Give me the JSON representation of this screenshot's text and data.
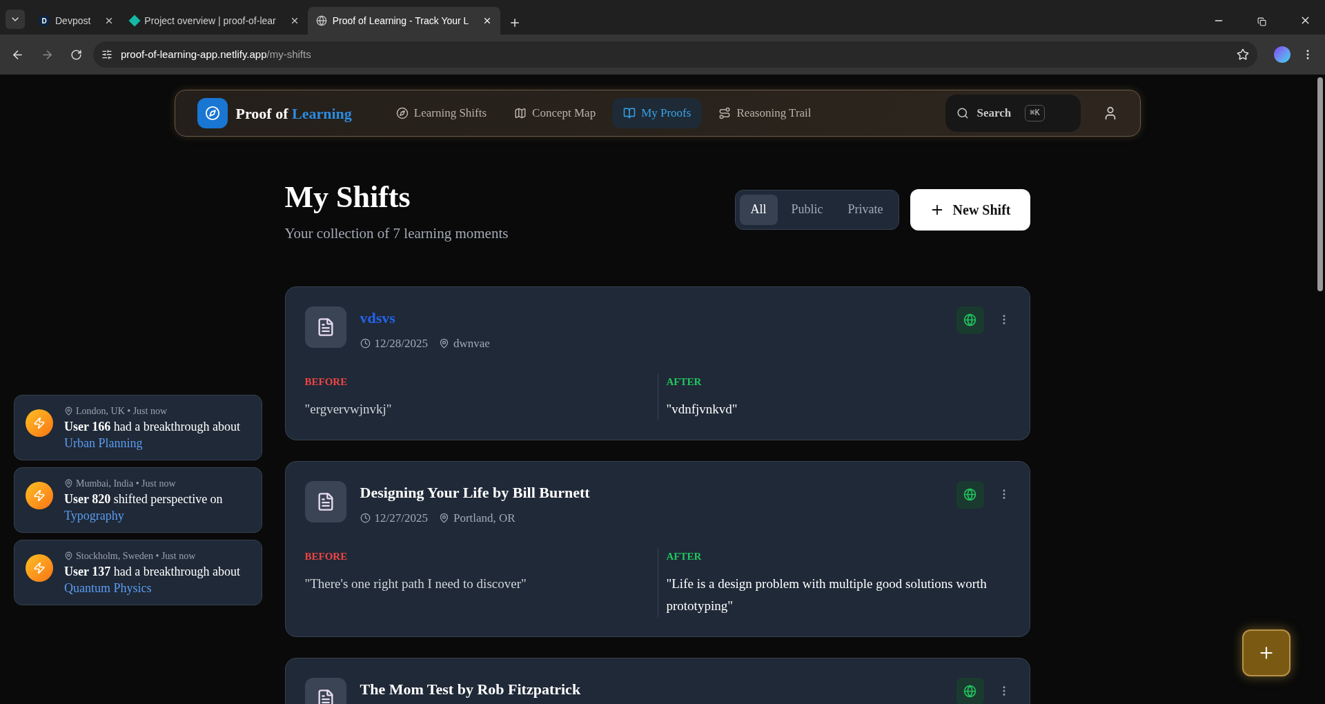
{
  "browser": {
    "tabs": [
      {
        "title": "Devpost",
        "letter": "D",
        "selected": false
      },
      {
        "title": "Project overview | proof-of-lear",
        "selected": false
      },
      {
        "title": "Proof of Learning - Track Your L",
        "selected": true
      }
    ],
    "url_host": "proof-of-learning-app.netlify.app",
    "url_path": "/my-shifts"
  },
  "nav": {
    "brand": [
      "Proof of",
      "Learning"
    ],
    "items": [
      {
        "label": "Learning Shifts",
        "selected": false
      },
      {
        "label": "Concept Map",
        "selected": false
      },
      {
        "label": "My Proofs",
        "selected": true
      },
      {
        "label": "Reasoning Trail",
        "selected": false
      }
    ],
    "search": {
      "label": "Search",
      "shortcut": "⌘K"
    }
  },
  "header": {
    "title": "My Shifts",
    "subtitle": "Your collection of 7 learning moments",
    "filters": [
      {
        "label": "All",
        "selected": true
      },
      {
        "label": "Public",
        "selected": false
      },
      {
        "label": "Private",
        "selected": false
      }
    ],
    "new_button": "New Shift"
  },
  "shifts": [
    {
      "title": "vdsvs",
      "highlighted": true,
      "date": "12/28/2025",
      "location": "dwnvae",
      "public": true,
      "before_label": "BEFORE",
      "before": "\"ergvervwjnvkj\"",
      "after_label": "AFTER",
      "after": "\"vdnfjvnkvd\""
    },
    {
      "title": "Designing Your Life by Bill Burnett",
      "highlighted": false,
      "date": "12/27/2025",
      "location": "Portland, OR",
      "public": true,
      "before_label": "BEFORE",
      "before": "\"There's one right path I need to discover\"",
      "after_label": "AFTER",
      "after": "\"Life is a design problem with multiple good solutions worth prototyping\""
    },
    {
      "title": "The Mom Test by Rob Fitzpatrick",
      "highlighted": false,
      "public": true
    }
  ],
  "toasts": [
    {
      "location": "London, UK • Just now",
      "message": "**User 166** had a breakthrough about",
      "topic": "Urban Planning"
    },
    {
      "location": "Mumbai, India • Just now",
      "message": "**User 820** shifted perspective on",
      "topic": "Typography"
    },
    {
      "location": "Stockholm, Sweden • Just now",
      "message": "**User 137** had a breakthrough about",
      "topic": "Quantum Physics"
    }
  ]
}
